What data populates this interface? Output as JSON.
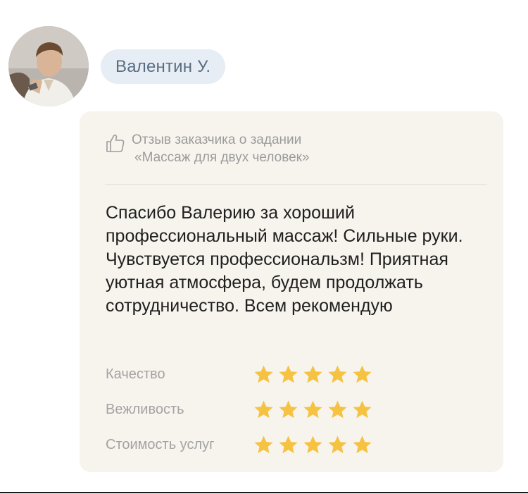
{
  "user": {
    "name": "Валентин У."
  },
  "review": {
    "header_line1": "Отзыв заказчика о задании",
    "header_line2": "«Массаж для двух человек»",
    "text": "Спасибо Валерию за хороший профессиональный массаж! Сильные руки. Чувствуется профессиональзм! Приятная уютная атмосфера, будем продолжать сотрудничество. Всем рекомендую"
  },
  "ratings": [
    {
      "label": "Качество",
      "stars": 5,
      "max": 5
    },
    {
      "label": "Вежливость",
      "stars": 5,
      "max": 5
    },
    {
      "label": "Стоимость услуг",
      "stars": 5,
      "max": 5
    }
  ],
  "colors": {
    "star": "#f5c242",
    "card_bg": "#f7f4ee",
    "chip_bg": "#e7edf4",
    "chip_text": "#5a6d82"
  },
  "icons": {
    "header": "thumbs-up-icon",
    "rating": "star-icon"
  }
}
